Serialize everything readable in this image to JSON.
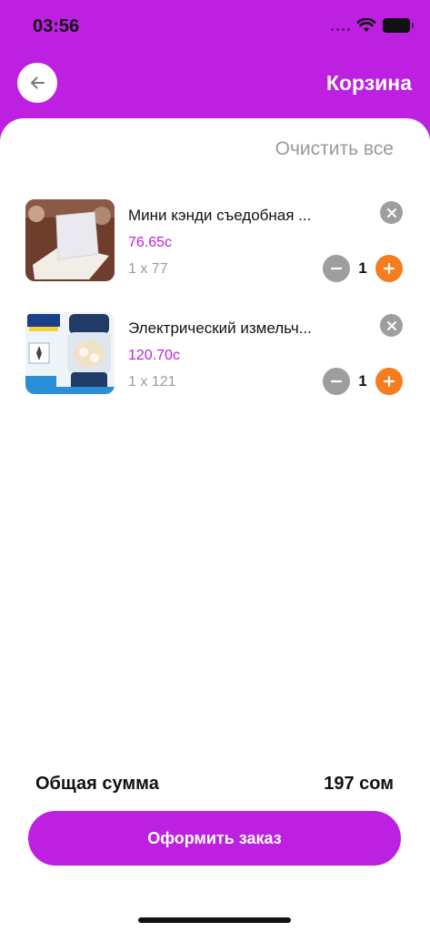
{
  "status_bar": {
    "time": "03:56"
  },
  "header": {
    "title": "Корзина"
  },
  "cart": {
    "clear_all_label": "Очистить все",
    "items": [
      {
        "title": "Мини кэнди съедобная ...",
        "price": "76.65с",
        "qty_text": "1 x 77",
        "quantity": "1"
      },
      {
        "title": "Электрический измельч...",
        "price": "120.70с",
        "qty_text": "1 x 121",
        "quantity": "1"
      }
    ]
  },
  "summary": {
    "total_label": "Общая сумма",
    "total_value": "197 сом"
  },
  "checkout": {
    "label": "Оформить заказ"
  },
  "colors": {
    "accent": "#bd20e0",
    "increment": "#f57c1f",
    "muted": "#9e9e9e"
  }
}
